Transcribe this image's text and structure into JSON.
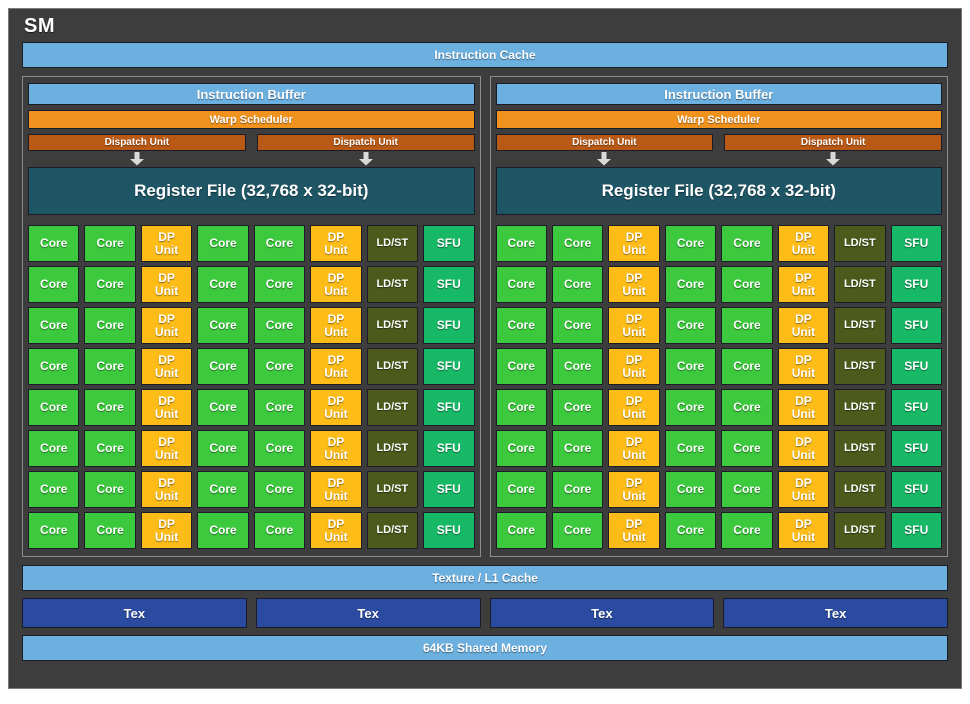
{
  "diagram": {
    "title": "SM",
    "instruction_cache": "Instruction Cache",
    "texture_l1_cache": "Texture / L1 Cache",
    "shared_memory": "64KB Shared Memory",
    "tex_label": "Tex",
    "tex_count": 4
  },
  "partition": {
    "instruction_buffer": "Instruction Buffer",
    "warp_scheduler": "Warp Scheduler",
    "dispatch_unit": "Dispatch Unit",
    "dispatch_unit_count": 2,
    "register_file": "Register File (32,768 x 32-bit)",
    "arrow_icon": "down-arrow",
    "rows": 8,
    "columns": 8,
    "column_pattern": [
      "Core",
      "Core",
      "DP Unit",
      "Core",
      "Core",
      "DP Unit",
      "LD/ST",
      "SFU"
    ],
    "unit_labels": {
      "core": "Core",
      "dp_unit_line1": "DP",
      "dp_unit_line2": "Unit",
      "ld_st": "LD/ST",
      "sfu": "SFU"
    }
  },
  "partitions": [
    {
      "id": "left"
    },
    {
      "id": "right"
    }
  ],
  "colors": {
    "panel_background": "#3d3d3d",
    "panel_border": "#7a7a7a",
    "partition_border": "#8d8d8d",
    "light_blue": "#6cb0e0",
    "orange": "#f0921e",
    "dispatch_orange": "#b85a15",
    "teal": "#1f5666",
    "core_green": "#3dc93d",
    "dp_yellow": "#fdbc17",
    "ldst_olive": "#4c5a1c",
    "sfu_green": "#17b866",
    "tex_blue": "#2b4ba0",
    "block_border": "#1c1c28",
    "text": "#ffffff"
  }
}
